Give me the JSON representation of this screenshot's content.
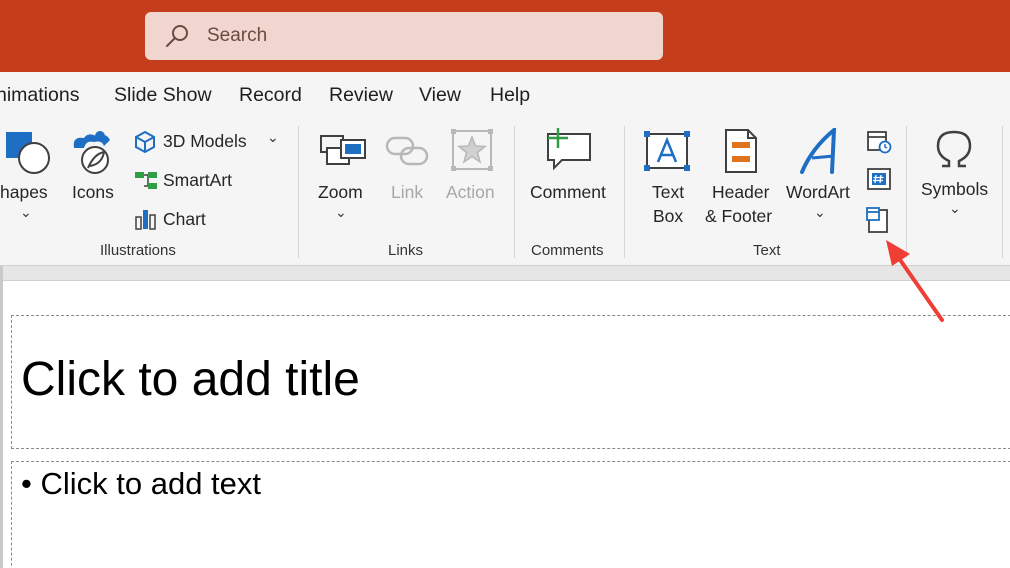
{
  "search": {
    "label": "Search"
  },
  "menu": {
    "items": [
      "nimations",
      "Slide Show",
      "Record",
      "Review",
      "View",
      "Help"
    ]
  },
  "ribbon": {
    "illustrations": {
      "shapes_label": "hapes",
      "icons_label": "Icons",
      "models_label": "3D Models",
      "smartart_label": "SmartArt",
      "chart_label": "Chart",
      "group_label": "Illustrations"
    },
    "links": {
      "zoom_label": "Zoom",
      "link_label": "Link",
      "action_label": "Action",
      "group_label": "Links"
    },
    "comments": {
      "comment_label": "Comment",
      "group_label": "Comments"
    },
    "text": {
      "textbox_line1": "Text",
      "textbox_line2": "Box",
      "header_line1": "Header",
      "header_line2": "& Footer",
      "wordart_label": "WordArt",
      "group_label": "Text"
    },
    "symbols": {
      "symbols_label": "Symbols"
    }
  },
  "slide": {
    "title_placeholder": "Click to add title",
    "body_placeholder": "Click to add text",
    "bullet": "•"
  },
  "colors": {
    "titlebar": "#c43e1c",
    "accent_blue": "#1e6fc3",
    "accent_orange": "#e0741b",
    "accent_green": "#2f9e44",
    "arrow": "#ef3e36"
  }
}
